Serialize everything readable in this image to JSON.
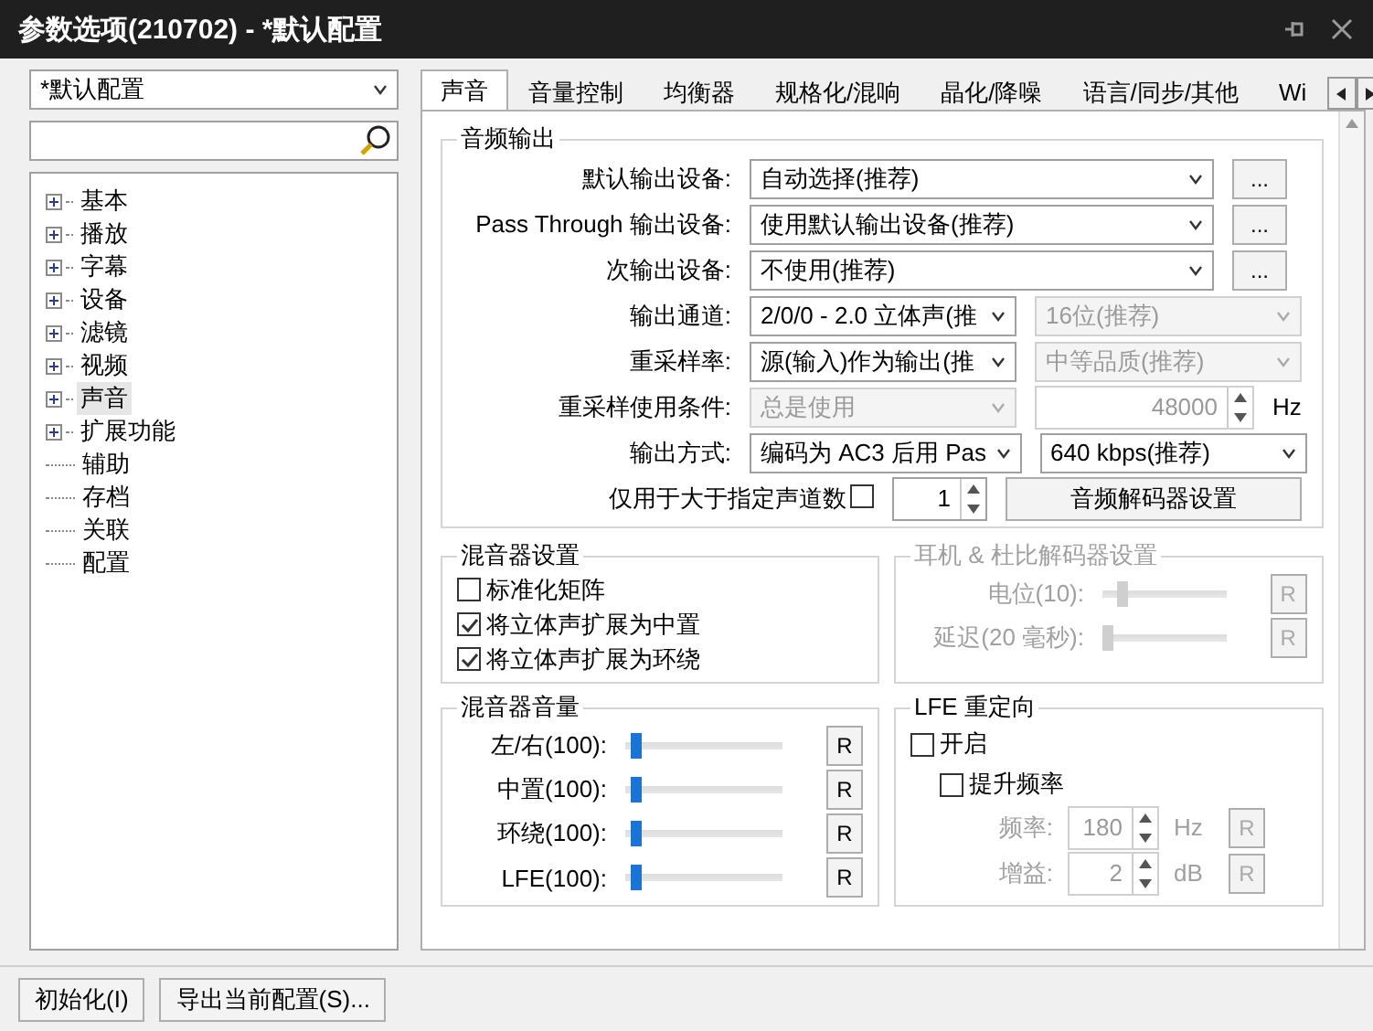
{
  "window": {
    "title": "参数选项(210702) - *默认配置"
  },
  "profile_select": {
    "value": "*默认配置"
  },
  "tree": [
    {
      "label": "基本",
      "expanded": false,
      "selected": false
    },
    {
      "label": "播放",
      "expanded": false,
      "selected": false
    },
    {
      "label": "字幕",
      "expanded": false,
      "selected": false
    },
    {
      "label": "设备",
      "expanded": false,
      "selected": false
    },
    {
      "label": "滤镜",
      "expanded": false,
      "selected": false
    },
    {
      "label": "视频",
      "expanded": false,
      "selected": false
    },
    {
      "label": "声音",
      "expanded": false,
      "selected": true
    },
    {
      "label": "扩展功能",
      "expanded": false,
      "selected": false
    },
    {
      "label": "辅助",
      "selected": false
    },
    {
      "label": "存档",
      "selected": false
    },
    {
      "label": "关联",
      "selected": false
    },
    {
      "label": "配置",
      "selected": false
    }
  ],
  "tabs": [
    {
      "label": "声音",
      "selected": true
    },
    {
      "label": "音量控制",
      "selected": false
    },
    {
      "label": "均衡器",
      "selected": false
    },
    {
      "label": "规格化/混响",
      "selected": false
    },
    {
      "label": "晶化/降噪",
      "selected": false
    },
    {
      "label": "语言/同步/其他",
      "selected": false
    },
    {
      "label": "Wi",
      "selected": false
    }
  ],
  "audio_output": {
    "title": "音频输出",
    "rows": [
      {
        "label": "默认输出设备:",
        "fields": [
          {
            "kind": "wide-select",
            "value": "自动选择(推荐)",
            "disabled": false
          },
          {
            "kind": "more",
            "text": "..."
          }
        ]
      },
      {
        "label": "Pass Through 输出设备:",
        "fields": [
          {
            "kind": "wide-select",
            "value": "使用默认输出设备(推荐)",
            "disabled": false
          },
          {
            "kind": "more",
            "text": "..."
          }
        ]
      },
      {
        "label": "次输出设备:",
        "fields": [
          {
            "kind": "wide-select",
            "value": "不使用(推荐)",
            "disabled": false
          },
          {
            "kind": "more",
            "text": "..."
          }
        ]
      },
      {
        "label": "输出通道:",
        "fields": [
          {
            "kind": "select",
            "value": "2/0/0 - 2.0 立体声(推",
            "disabled": false
          },
          {
            "kind": "select",
            "value": "16位(推荐)",
            "disabled": true
          }
        ]
      },
      {
        "label": "重采样率:",
        "fields": [
          {
            "kind": "select",
            "value": "源(输入)作为输出(推",
            "disabled": false
          },
          {
            "kind": "select",
            "value": "中等品质(推荐)",
            "disabled": true
          }
        ]
      },
      {
        "label": "重采样使用条件:",
        "fields": [
          {
            "kind": "select",
            "value": "总是使用",
            "disabled": true
          },
          {
            "kind": "spin",
            "value": "48000",
            "unit": "Hz",
            "disabled": true
          }
        ]
      },
      {
        "label": "输出方式:",
        "fields": [
          {
            "kind": "select",
            "value": "编码为 AC3 后用 Pas",
            "disabled": false
          },
          {
            "kind": "select",
            "value": "640 kbps(推荐)",
            "disabled": false
          }
        ]
      }
    ],
    "channel_limit": {
      "label": "仅用于大于指定声道数",
      "checked": false,
      "value": "1"
    },
    "decoder_button": "音频解码器设置"
  },
  "mixer_settings": {
    "title": "混音器设置",
    "options": [
      {
        "label": "标准化矩阵",
        "checked": false
      },
      {
        "label": "将立体声扩展为中置",
        "checked": true
      },
      {
        "label": "将立体声扩展为环绕",
        "checked": true
      }
    ]
  },
  "headphone": {
    "title": "耳机 & 杜比解码器设置",
    "disabled": true,
    "sliders": [
      {
        "label": "电位(10):",
        "level": 0.15,
        "reset": "R"
      },
      {
        "label": "延迟(20 毫秒):",
        "level": 0.03,
        "reset": "R"
      }
    ]
  },
  "mixer_volume": {
    "title": "混音器音量",
    "sliders": [
      {
        "label": "左/右(100):",
        "level": 0.1,
        "reset": "R"
      },
      {
        "label": "中置(100):",
        "level": 0.1,
        "reset": "R"
      },
      {
        "label": "环绕(100):",
        "level": 0.1,
        "reset": "R"
      },
      {
        "label": "LFE(100):",
        "level": 0.1,
        "reset": "R"
      }
    ]
  },
  "lfe": {
    "title": "LFE 重定向",
    "enable": {
      "label": "开启",
      "checked": false
    },
    "boost": {
      "label": "提升频率",
      "checked": false
    },
    "fields": [
      {
        "label": "频率:",
        "value": "180",
        "unit": "Hz",
        "reset": "R",
        "disabled": true
      },
      {
        "label": "增益:",
        "value": "2",
        "unit": "dB",
        "reset": "R",
        "disabled": true
      }
    ]
  },
  "bottom_buttons": [
    "初始化(I)",
    "导出当前配置(S)..."
  ]
}
